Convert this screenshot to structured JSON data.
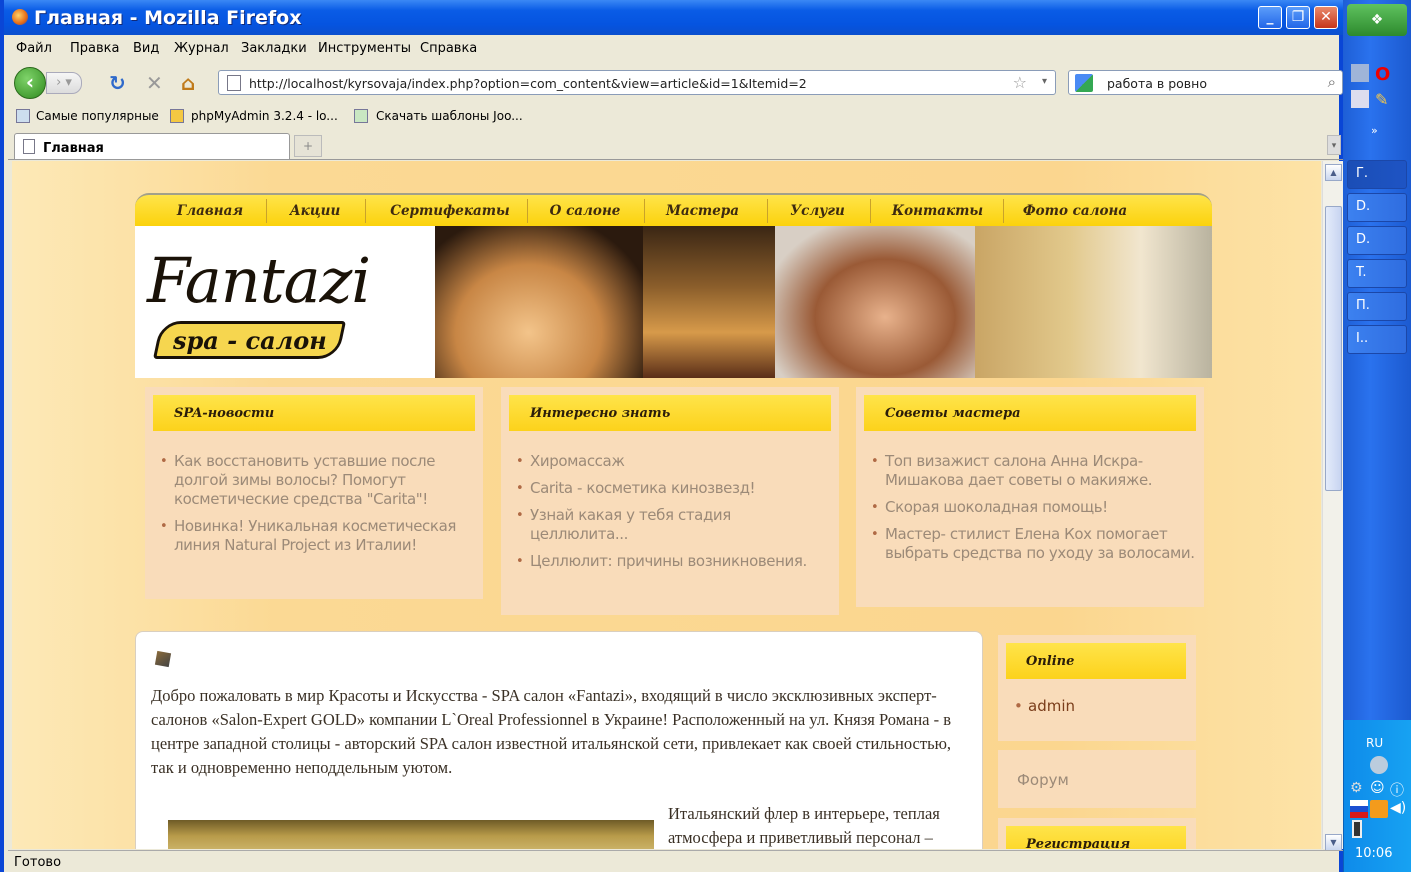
{
  "window": {
    "title": "Главная - Mozilla Firefox",
    "min": "_",
    "max": "❐",
    "close": "✕"
  },
  "menu": [
    "Файл",
    "Правка",
    "Вид",
    "Журнал",
    "Закладки",
    "Инструменты",
    "Справка"
  ],
  "nav": {
    "url": "http://localhost/kyrsovaja/index.php?option=com_content&view=article&id=1&Itemid=2",
    "search": "работа в ровно"
  },
  "bookmarks": [
    "Самые популярные",
    "phpMyAdmin 3.2.4 - lo...",
    "Скачать шаблоны Joo..."
  ],
  "tabs": [
    {
      "label": "Главная"
    }
  ],
  "status": "Готово",
  "site": {
    "menu": [
      "Главная",
      "Акции",
      "Сертифекаты",
      "О салоне",
      "Мастера",
      "Услуги",
      "Контакты",
      "Фото салона"
    ],
    "logo": {
      "name": "Fantazi",
      "tagline": "spa - салон"
    },
    "columns": [
      {
        "title": "SPA-новости",
        "items": [
          "Как восстановить уставшие после долгой зимы волосы? Помогут косметические средства \"Carita\"!",
          "Новинка! Уникальная косметическая линия Natural Project из Италии!"
        ]
      },
      {
        "title": "Интересно знать",
        "items": [
          "Хиромассаж",
          "Carita - косметика кинозвезд!",
          "Узнай какая у тебя стадия целлюлита...",
          "Целлюлит: причины возникновения."
        ]
      },
      {
        "title": "Советы мастера",
        "items": [
          "Топ визажист салона Анна Искра-Мишакова дает советы о макияже.",
          "Скорая шоколадная помощь!",
          "Мастер- стилист Елена Кох помогает выбрать средства по уходу за волосами."
        ]
      }
    ],
    "intro": "Добро пожаловать в мир Красоты и Искусства - SPA салон «Fantazi», входящий в число эксклюзивных эксперт-салонов «Salon-Expert GOLD» компании L`Oreal Professionnel в Украине! Расположенный на ул. Князя Романа - в центре западной столицы - авторский SPA салон известной итальянской сети, привлекает как своей стильностью, так и одновременно неподдельным уютом.",
    "sub": "Итальянский флер в интерьере, теплая атмосфера и приветливый персонал –",
    "sidebar": {
      "online_title": "Online",
      "online_user": "admin",
      "forum": "Форум",
      "register_title": "Регистрация"
    }
  },
  "taskbar": {
    "items": [
      "Г.",
      "D.",
      "D.",
      "T.",
      "П.",
      "I.."
    ],
    "lang": "RU",
    "clock": "10:06"
  }
}
